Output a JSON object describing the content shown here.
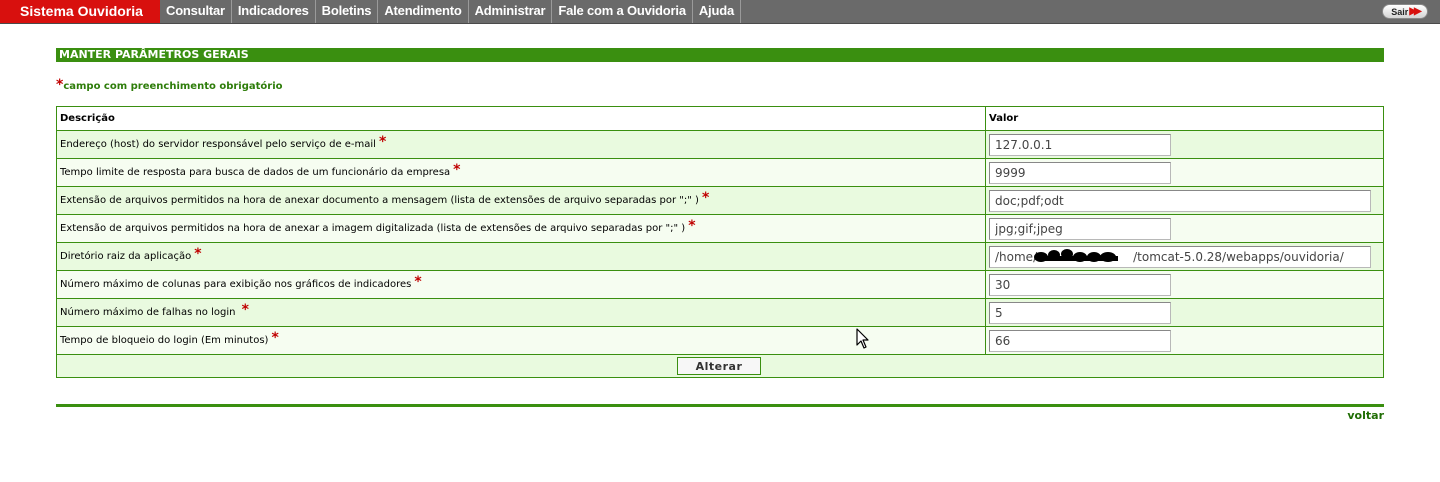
{
  "app": {
    "brand": "Sistema Ouvidoria",
    "menu": [
      "Consultar",
      "Indicadores",
      "Boletins",
      "Atendimento",
      "Administrar",
      "Fale com a Ouvidoria",
      "Ajuda"
    ],
    "logout_label": "Sair",
    "logout_icon": "double-arrow-right-icon"
  },
  "page": {
    "title": "MANTER PARÂMETROS GERAIS",
    "required_star": "*",
    "required_note": "campo com preenchimento obrigatório",
    "headers": {
      "description": "Descrição",
      "value": "Valor"
    },
    "rows": [
      {
        "label": "Endereço (host) do servidor responsável pelo serviço de e-mail",
        "value": "127.0.0.1"
      },
      {
        "label": "Tempo limite de resposta para busca de dados de um funcionário da empresa",
        "value": "9999"
      },
      {
        "label": "Extensão de arquivos permitidos na hora de anexar documento a mensagem (lista de extensões de arquivo separadas por \";\" )",
        "value": "doc;pdf;odt"
      },
      {
        "label": "Extensão de arquivos permitidos na hora de anexar a imagem digitalizada (lista de extensões de arquivo separadas por \";\" )",
        "value": "jpg;gif;jpeg"
      },
      {
        "label": "Diretório raiz da aplicação",
        "value": "/home/        /tomcat-5.0.28/webapps/ouvidoria/"
      },
      {
        "label": "Número máximo de colunas para exibição nos gráficos de indicadores",
        "value": "30"
      },
      {
        "label": "Número máximo de falhas no login ",
        "value": "5"
      },
      {
        "label": "Tempo de bloqueio do login (Em minutos)",
        "value": "66"
      }
    ],
    "submit_label": "Alterar",
    "back_link": "voltar"
  },
  "colors": {
    "brand_red": "#d8100e",
    "topbar_gray": "#6a6a6a",
    "accent_green": "#3a8f10",
    "row_tint": "#e9fadf",
    "required_red": "#c00000"
  }
}
